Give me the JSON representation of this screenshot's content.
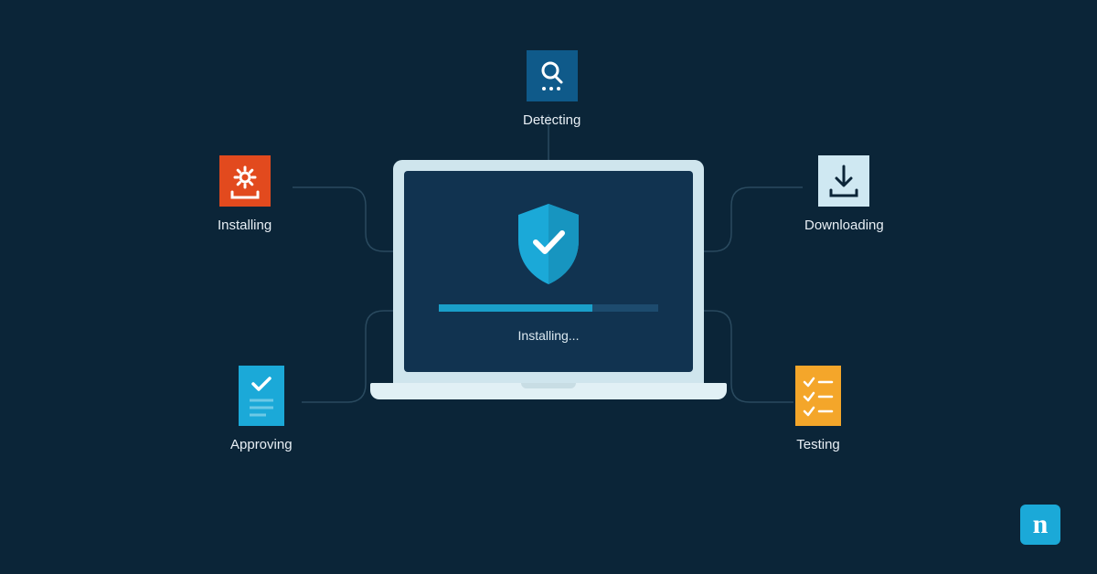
{
  "center": {
    "status_text": "Installing...",
    "progress_percent": 70
  },
  "nodes": {
    "detecting": {
      "label": "Detecting",
      "color": "#0f5a8a",
      "icon": "search-icon"
    },
    "downloading": {
      "label": "Downloading",
      "color": "#cfe8f2",
      "icon": "download-icon"
    },
    "testing": {
      "label": "Testing",
      "color": "#f4a62a",
      "icon": "checklist-icon"
    },
    "approving": {
      "label": "Approving",
      "color": "#1ba9d8",
      "icon": "document-check-icon"
    },
    "installing": {
      "label": "Installing",
      "color": "#e24a1e",
      "icon": "gear-install-icon"
    }
  },
  "logo": {
    "letter": "n"
  }
}
